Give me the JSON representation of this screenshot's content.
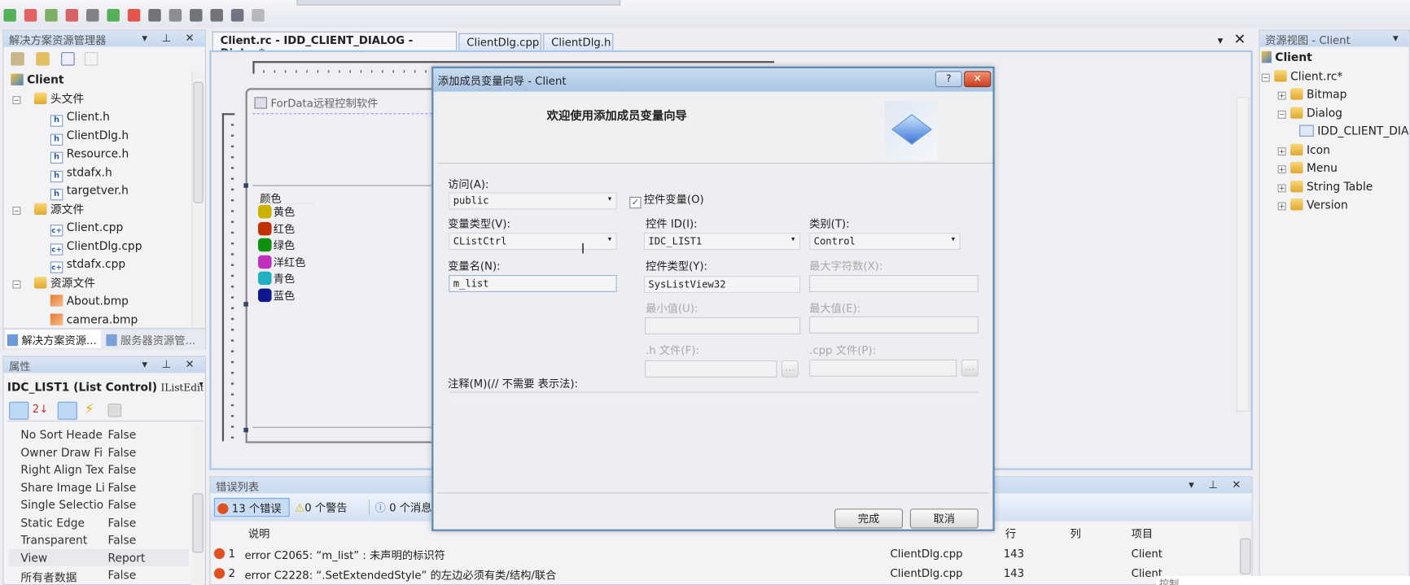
{
  "toolbar": {
    "icons": [
      "start-icon",
      "debug-icon",
      "build-icon",
      "rebuild-icon",
      "clean-icon",
      "step-icon",
      "breakpoint-icon",
      "find-icon",
      "indent-icon",
      "comment-icon",
      "bookmark-icon",
      "tools-icon",
      "overflow-icon"
    ]
  },
  "solution_explorer": {
    "title": "解决方案资源管理器",
    "root": "Client",
    "items": [
      {
        "label": "头文件",
        "type": "folder",
        "level": 1
      },
      {
        "label": "Client.h",
        "type": "h",
        "level": 2
      },
      {
        "label": "ClientDlg.h",
        "type": "h",
        "level": 2
      },
      {
        "label": "Resource.h",
        "type": "h",
        "level": 2
      },
      {
        "label": "stdafx.h",
        "type": "h",
        "level": 2
      },
      {
        "label": "targetver.h",
        "type": "h",
        "level": 2
      },
      {
        "label": "源文件",
        "type": "folder",
        "level": 1
      },
      {
        "label": "Client.cpp",
        "type": "cpp",
        "level": 2
      },
      {
        "label": "ClientDlg.cpp",
        "type": "cpp",
        "level": 2
      },
      {
        "label": "stdafx.cpp",
        "type": "cpp",
        "level": 2
      },
      {
        "label": "资源文件",
        "type": "folder",
        "level": 1
      },
      {
        "label": "About.bmp",
        "type": "bmp",
        "level": 2
      },
      {
        "label": "camera.bmp",
        "type": "bmp",
        "level": 2
      }
    ],
    "tabs": [
      "解决方案资源...",
      "服务器资源管..."
    ]
  },
  "properties": {
    "title": "属性",
    "object": "IDC_LIST1 (List Control)",
    "object_type": "IListEdit‹",
    "rows": [
      [
        "No Sort Heade",
        "False"
      ],
      [
        "Owner Draw Fi",
        "False"
      ],
      [
        "Right Align Tex",
        "False"
      ],
      [
        "Share Image Li",
        "False"
      ],
      [
        "Single Selectio",
        "False"
      ],
      [
        "Static Edge",
        "False"
      ],
      [
        "Transparent",
        "False"
      ],
      [
        "View",
        "Report"
      ],
      [
        "所有者数据",
        "False"
      ]
    ]
  },
  "editor": {
    "tabs": [
      "Client.rc - IDD_CLIENT_DIALOG - Dialog*",
      "ClientDlg.cpp",
      "ClientDlg.h"
    ],
    "dialog_title": "ForData远程控制软件",
    "list_header": "颜色",
    "colors": [
      {
        "label": "黄色",
        "color": "#c8b400"
      },
      {
        "label": "红色",
        "color": "#c03000"
      },
      {
        "label": "绿色",
        "color": "#109010"
      },
      {
        "label": "洋红色",
        "color": "#c030c0"
      },
      {
        "label": "青色",
        "color": "#20b0c0"
      },
      {
        "label": "蓝色",
        "color": "#101890"
      }
    ]
  },
  "wizard": {
    "title": "添加成员变量向导 - Client",
    "heading": "欢迎使用添加成员变量向导",
    "access_label": "访问(A):",
    "access_value": "public",
    "control_var_label": "控件变量(O)",
    "control_var_checked": true,
    "var_type_label": "变量类型(V):",
    "var_type_value": "CListCtrl",
    "control_id_label": "控件 ID(I):",
    "control_id_value": "IDC_LIST1",
    "category_label": "类别(T):",
    "category_value": "Control",
    "var_name_label": "变量名(N):",
    "var_name_value": "m_list",
    "control_type_label": "控件类型(Y):",
    "control_type_value": "SysListView32",
    "max_chars_label": "最大字符数(X):",
    "min_label": "最小值(U):",
    "max_label": "最大值(E):",
    "h_file_label": ".h 文件(F):",
    "cpp_file_label": ".cpp 文件(P):",
    "browse": "...",
    "comment_label": "注释(M)(// 不需要 表示法):",
    "finish": "完成",
    "cancel": "取消",
    "help": "?",
    "close": "✕"
  },
  "error_list": {
    "title": "错误列表",
    "errors_btn": "13 个错误",
    "warnings_btn": "0 个警告",
    "messages_btn": "0 个消息",
    "columns": [
      "说明",
      "行",
      "列",
      "项目"
    ],
    "rows": [
      {
        "num": "1",
        "desc": "error C2065: “m_list” : 未声明的标识符",
        "file": "ClientDlg.cpp",
        "line": "143",
        "col": "",
        "project": "Client"
      },
      {
        "num": "2",
        "desc": "error C2228: “.SetExtendedStyle” 的左边必须有类/结构/联合",
        "file": "ClientDlg.cpp",
        "line": "143",
        "col": "",
        "project": "Client"
      }
    ]
  },
  "resource_view": {
    "title": "资源视图 - Client",
    "root": "Client",
    "rc": "Client.rc*",
    "items": [
      {
        "label": "Bitmap",
        "exp": "+"
      },
      {
        "label": "Dialog",
        "exp": "−"
      },
      {
        "label": "IDD_CLIENT_DIALOG",
        "child": true
      },
      {
        "label": "Icon",
        "exp": "+"
      },
      {
        "label": "Menu",
        "exp": "+"
      },
      {
        "label": "String Table",
        "exp": "+"
      },
      {
        "label": "Version",
        "exp": "+"
      }
    ]
  },
  "tooltip": "控制"
}
